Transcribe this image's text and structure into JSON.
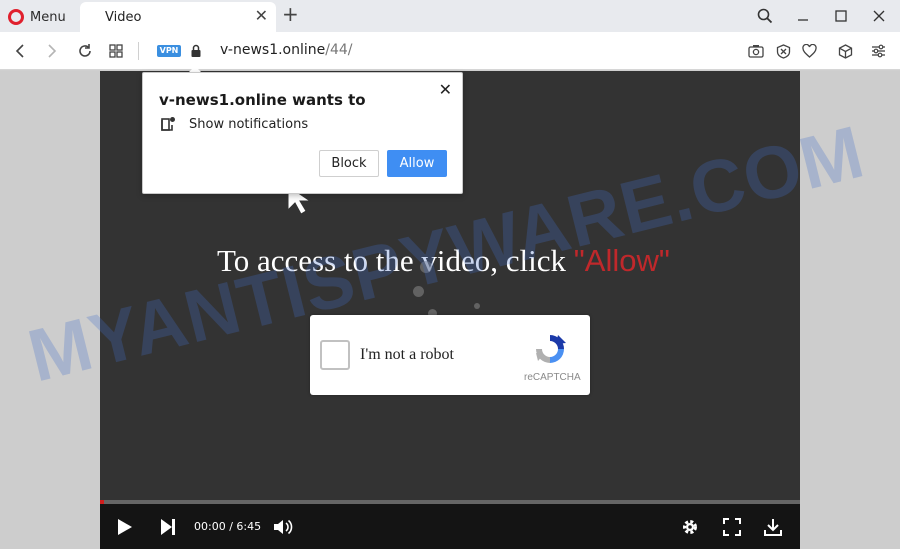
{
  "browser": {
    "menu_label": "Menu",
    "tab_title": "Video",
    "vpn_badge": "VPN",
    "url_host": "v-news1.online",
    "url_path": "/44/"
  },
  "popup": {
    "title": "v-news1.online wants to",
    "permission": "Show notifications",
    "block_label": "Block",
    "allow_label": "Allow"
  },
  "page": {
    "headline": "To access to the video, click",
    "headline_allow": "\"Allow\"",
    "watermark": "MYANTISPYWARE.COM"
  },
  "captcha": {
    "label": "I'm not a robot",
    "brand": "reCAPTCHA"
  },
  "player": {
    "time": "00:00 / 6:45",
    "progress": 0
  },
  "colors": {
    "accent": "#3f8ef3",
    "opera_red": "#e0202d",
    "allow_red": "#c0282b"
  }
}
